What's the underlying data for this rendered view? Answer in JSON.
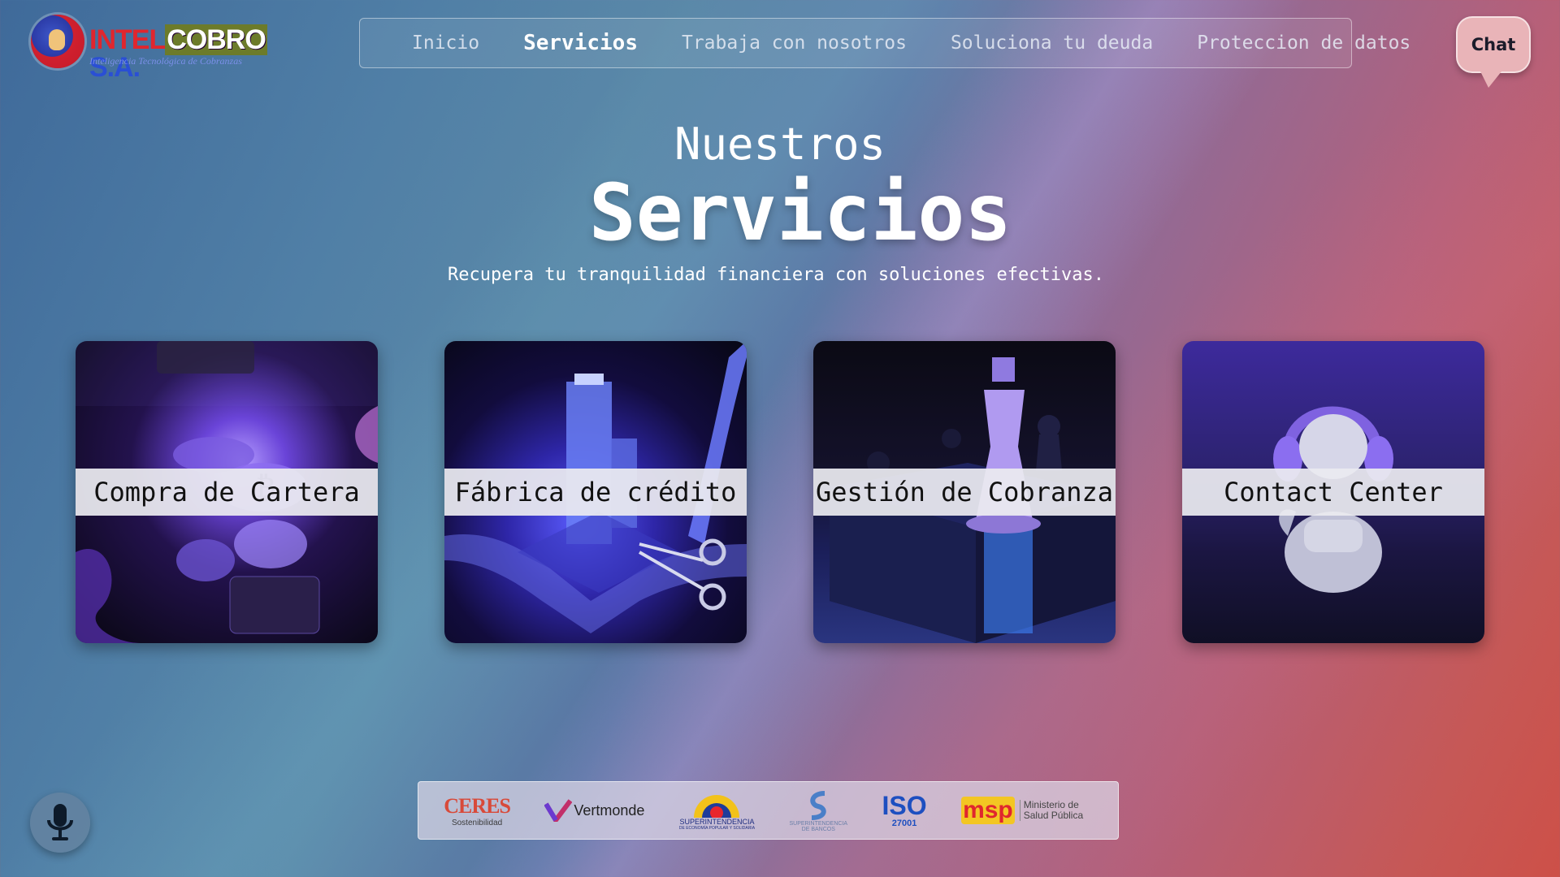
{
  "brand": {
    "name_part1": "INTEL",
    "name_part2": "COBRO",
    "name_part3": " S.A.",
    "tagline": "Inteligencia Tecnológica de Cobranzas"
  },
  "nav": {
    "items": [
      {
        "label": "Inicio",
        "active": false
      },
      {
        "label": "Servicios",
        "active": true
      },
      {
        "label": "Trabaja con nosotros",
        "active": false
      },
      {
        "label": "Soluciona tu deuda",
        "active": false
      },
      {
        "label": "Proteccion de datos",
        "active": false
      }
    ]
  },
  "chat": {
    "label": "Chat"
  },
  "hero": {
    "eyebrow": "Nuestros",
    "title": "Servicios",
    "subtitle": "Recupera tu tranquilidad financiera con soluciones efectivas."
  },
  "cards": [
    {
      "label": "Compra de Cartera",
      "image_icon": "crypto-coins-briefcase"
    },
    {
      "label": "Fábrica de crédito",
      "image_icon": "building-scissors"
    },
    {
      "label": "Gestión de Cobranza",
      "image_icon": "chess-king"
    },
    {
      "label": "Contact Center",
      "image_icon": "headset-astronaut"
    }
  ],
  "partners": [
    {
      "name": "CERES",
      "caption": "Sostenibilidad"
    },
    {
      "name": "Vertmonde"
    },
    {
      "name": "SUPERINTENDENCIA",
      "caption": "DE ECONOMÍA POPULAR Y SOLIDARIA"
    },
    {
      "name": "SUPERINTENDENCIA",
      "caption": "DE BANCOS"
    },
    {
      "name": "ISO",
      "caption": "27001"
    },
    {
      "name": "msp",
      "caption": "Ministerio de Salud Pública"
    }
  ],
  "colors": {
    "accent_red": "#e0262e",
    "accent_blue": "#2a4fd4",
    "chat_bg": "#e9b4b8"
  }
}
